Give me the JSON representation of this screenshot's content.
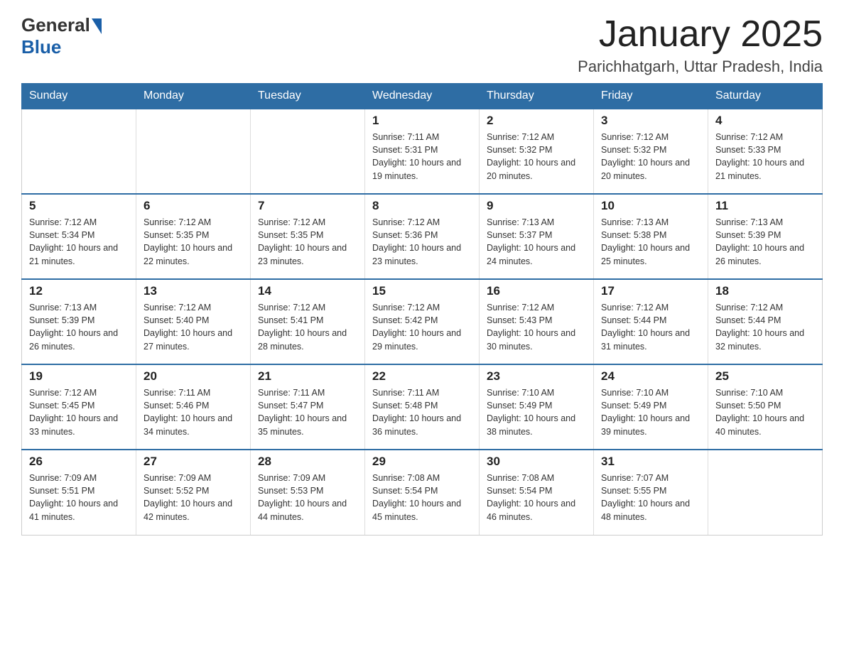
{
  "header": {
    "logo": {
      "general": "General",
      "blue": "Blue"
    },
    "title": "January 2025",
    "subtitle": "Parichhatgarh, Uttar Pradesh, India"
  },
  "weekdays": [
    "Sunday",
    "Monday",
    "Tuesday",
    "Wednesday",
    "Thursday",
    "Friday",
    "Saturday"
  ],
  "weeks": [
    [
      {
        "day": "",
        "info": ""
      },
      {
        "day": "",
        "info": ""
      },
      {
        "day": "",
        "info": ""
      },
      {
        "day": "1",
        "info": "Sunrise: 7:11 AM\nSunset: 5:31 PM\nDaylight: 10 hours\nand 19 minutes."
      },
      {
        "day": "2",
        "info": "Sunrise: 7:12 AM\nSunset: 5:32 PM\nDaylight: 10 hours\nand 20 minutes."
      },
      {
        "day": "3",
        "info": "Sunrise: 7:12 AM\nSunset: 5:32 PM\nDaylight: 10 hours\nand 20 minutes."
      },
      {
        "day": "4",
        "info": "Sunrise: 7:12 AM\nSunset: 5:33 PM\nDaylight: 10 hours\nand 21 minutes."
      }
    ],
    [
      {
        "day": "5",
        "info": "Sunrise: 7:12 AM\nSunset: 5:34 PM\nDaylight: 10 hours\nand 21 minutes."
      },
      {
        "day": "6",
        "info": "Sunrise: 7:12 AM\nSunset: 5:35 PM\nDaylight: 10 hours\nand 22 minutes."
      },
      {
        "day": "7",
        "info": "Sunrise: 7:12 AM\nSunset: 5:35 PM\nDaylight: 10 hours\nand 23 minutes."
      },
      {
        "day": "8",
        "info": "Sunrise: 7:12 AM\nSunset: 5:36 PM\nDaylight: 10 hours\nand 23 minutes."
      },
      {
        "day": "9",
        "info": "Sunrise: 7:13 AM\nSunset: 5:37 PM\nDaylight: 10 hours\nand 24 minutes."
      },
      {
        "day": "10",
        "info": "Sunrise: 7:13 AM\nSunset: 5:38 PM\nDaylight: 10 hours\nand 25 minutes."
      },
      {
        "day": "11",
        "info": "Sunrise: 7:13 AM\nSunset: 5:39 PM\nDaylight: 10 hours\nand 26 minutes."
      }
    ],
    [
      {
        "day": "12",
        "info": "Sunrise: 7:13 AM\nSunset: 5:39 PM\nDaylight: 10 hours\nand 26 minutes."
      },
      {
        "day": "13",
        "info": "Sunrise: 7:12 AM\nSunset: 5:40 PM\nDaylight: 10 hours\nand 27 minutes."
      },
      {
        "day": "14",
        "info": "Sunrise: 7:12 AM\nSunset: 5:41 PM\nDaylight: 10 hours\nand 28 minutes."
      },
      {
        "day": "15",
        "info": "Sunrise: 7:12 AM\nSunset: 5:42 PM\nDaylight: 10 hours\nand 29 minutes."
      },
      {
        "day": "16",
        "info": "Sunrise: 7:12 AM\nSunset: 5:43 PM\nDaylight: 10 hours\nand 30 minutes."
      },
      {
        "day": "17",
        "info": "Sunrise: 7:12 AM\nSunset: 5:44 PM\nDaylight: 10 hours\nand 31 minutes."
      },
      {
        "day": "18",
        "info": "Sunrise: 7:12 AM\nSunset: 5:44 PM\nDaylight: 10 hours\nand 32 minutes."
      }
    ],
    [
      {
        "day": "19",
        "info": "Sunrise: 7:12 AM\nSunset: 5:45 PM\nDaylight: 10 hours\nand 33 minutes."
      },
      {
        "day": "20",
        "info": "Sunrise: 7:11 AM\nSunset: 5:46 PM\nDaylight: 10 hours\nand 34 minutes."
      },
      {
        "day": "21",
        "info": "Sunrise: 7:11 AM\nSunset: 5:47 PM\nDaylight: 10 hours\nand 35 minutes."
      },
      {
        "day": "22",
        "info": "Sunrise: 7:11 AM\nSunset: 5:48 PM\nDaylight: 10 hours\nand 36 minutes."
      },
      {
        "day": "23",
        "info": "Sunrise: 7:10 AM\nSunset: 5:49 PM\nDaylight: 10 hours\nand 38 minutes."
      },
      {
        "day": "24",
        "info": "Sunrise: 7:10 AM\nSunset: 5:49 PM\nDaylight: 10 hours\nand 39 minutes."
      },
      {
        "day": "25",
        "info": "Sunrise: 7:10 AM\nSunset: 5:50 PM\nDaylight: 10 hours\nand 40 minutes."
      }
    ],
    [
      {
        "day": "26",
        "info": "Sunrise: 7:09 AM\nSunset: 5:51 PM\nDaylight: 10 hours\nand 41 minutes."
      },
      {
        "day": "27",
        "info": "Sunrise: 7:09 AM\nSunset: 5:52 PM\nDaylight: 10 hours\nand 42 minutes."
      },
      {
        "day": "28",
        "info": "Sunrise: 7:09 AM\nSunset: 5:53 PM\nDaylight: 10 hours\nand 44 minutes."
      },
      {
        "day": "29",
        "info": "Sunrise: 7:08 AM\nSunset: 5:54 PM\nDaylight: 10 hours\nand 45 minutes."
      },
      {
        "day": "30",
        "info": "Sunrise: 7:08 AM\nSunset: 5:54 PM\nDaylight: 10 hours\nand 46 minutes."
      },
      {
        "day": "31",
        "info": "Sunrise: 7:07 AM\nSunset: 5:55 PM\nDaylight: 10 hours\nand 48 minutes."
      },
      {
        "day": "",
        "info": ""
      }
    ]
  ]
}
